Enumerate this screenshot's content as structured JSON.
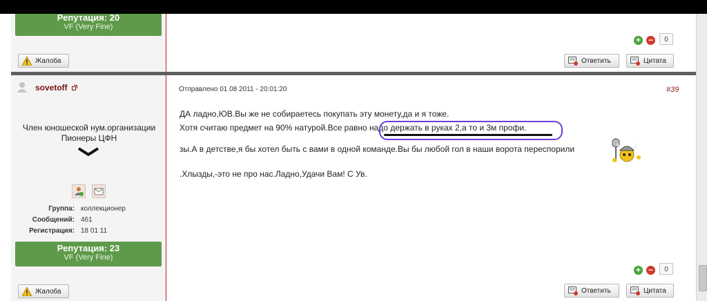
{
  "top_post": {
    "reputation_title": "Репутация: 20",
    "reputation_grade": "VF (Very Fine)",
    "vote_count": "0",
    "complaint_label": "Жалоба",
    "reply_label": "Ответить",
    "quote_label": "Цитата"
  },
  "post": {
    "username": "sovetoff",
    "user_title_line1": "Член юношеской нум.организации",
    "user_title_line2": "Пионеры ЦФН",
    "info": [
      {
        "label": "Группа:",
        "value": "коллекционер"
      },
      {
        "label": "Сообщений:",
        "value": "461"
      },
      {
        "label": "Регистрация:",
        "value": "18 01 11"
      }
    ],
    "reputation_title": "Репутация: 23",
    "reputation_grade": "VF (Very Fine)",
    "sent": "Отправлено 01 08 2011 - 20:01:20",
    "post_number": "#39",
    "body": {
      "line1": "ДА ладно,ЮВ.Вы же не собираетесь покупать эту монету,да и я тоже.",
      "line2": "Хотя считаю предмет на 90% натурой.Все равно надо держать в руках 2,а то и 3м профи.",
      "line3": "зы.А в детстве,я бы хотел быть с вами в одной команде.Вы бы любой гол в наши ворота переспорили",
      "line4": ".Хлызды,-это не про нас.Ладно,Удачи Вам! С Ув."
    },
    "vote_count": "0",
    "complaint_label": "Жалоба",
    "reply_label": "Ответить",
    "quote_label": "Цитата"
  }
}
